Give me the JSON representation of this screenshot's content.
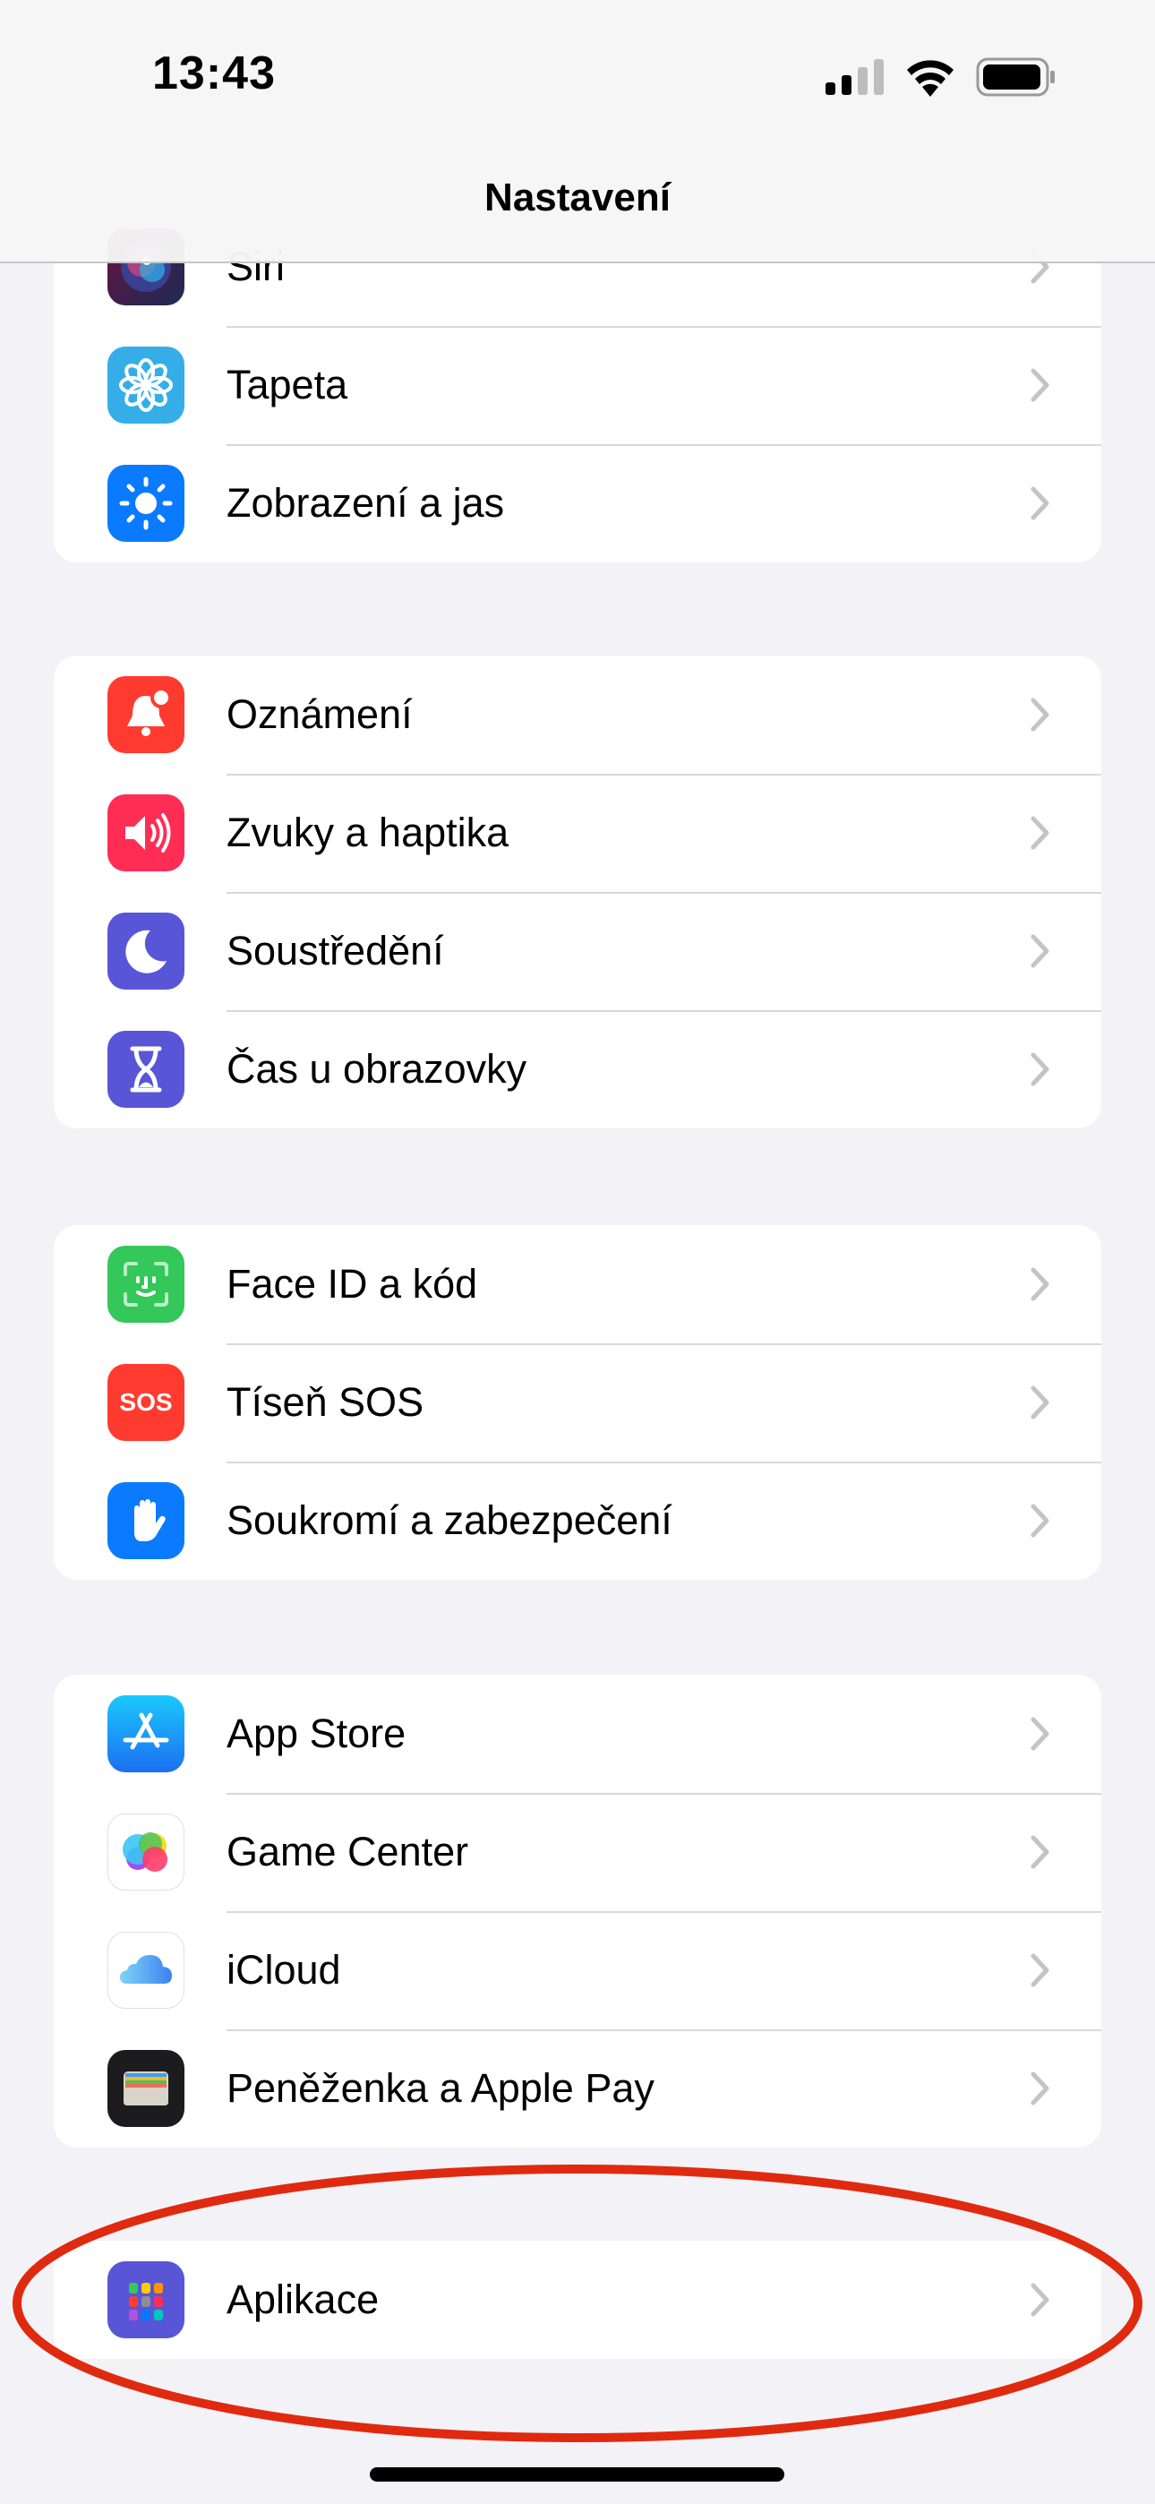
{
  "status_bar": {
    "time": "13:43",
    "signal_bars": 2,
    "signal_max": 4,
    "wifi": "wifi-icon",
    "battery_level": 0.9
  },
  "header": {
    "title": "Nastavení"
  },
  "groups": [
    {
      "items": [
        {
          "label": "Siri",
          "icon": "siri-icon",
          "color": "#2b2b5e"
        },
        {
          "label": "Tapeta",
          "icon": "flower-icon",
          "color": "#35aee8"
        },
        {
          "label": "Zobrazení a jas",
          "icon": "sun-icon",
          "color": "#0a7aff"
        }
      ]
    },
    {
      "items": [
        {
          "label": "Oznámení",
          "icon": "bell-badge-icon",
          "color": "#ff3b30"
        },
        {
          "label": "Zvuky a haptika",
          "icon": "speaker-icon",
          "color": "#ff2d55"
        },
        {
          "label": "Soustředění",
          "icon": "moon-icon",
          "color": "#5856d6"
        },
        {
          "label": "Čas u obrazovky",
          "icon": "hourglass-icon",
          "color": "#5856d6"
        }
      ]
    },
    {
      "items": [
        {
          "label": "Face ID a kód",
          "icon": "face-id-icon",
          "color": "#34c759"
        },
        {
          "label": "Tíseň SOS",
          "icon": "sos-icon",
          "color": "#ff3b30",
          "icon_text": "SOS"
        },
        {
          "label": "Soukromí a zabezpečení",
          "icon": "hand-icon",
          "color": "#0a7aff"
        }
      ]
    },
    {
      "items": [
        {
          "label": "App Store",
          "icon": "app-store-icon",
          "color": "#1a8cff"
        },
        {
          "label": "Game Center",
          "icon": "game-center-icon",
          "color": "#ffffff"
        },
        {
          "label": "iCloud",
          "icon": "icloud-icon",
          "color": "#ffffff"
        },
        {
          "label": "Peněženka a Apple Pay",
          "icon": "wallet-icon",
          "color": "#1c1c1e"
        }
      ]
    },
    {
      "items": [
        {
          "label": "Aplikace",
          "icon": "apps-grid-icon",
          "color": "#5856d6"
        }
      ]
    }
  ],
  "annotation": {
    "shape": "ellipse",
    "color": "#e02a10",
    "highlights": "Aplikace"
  }
}
